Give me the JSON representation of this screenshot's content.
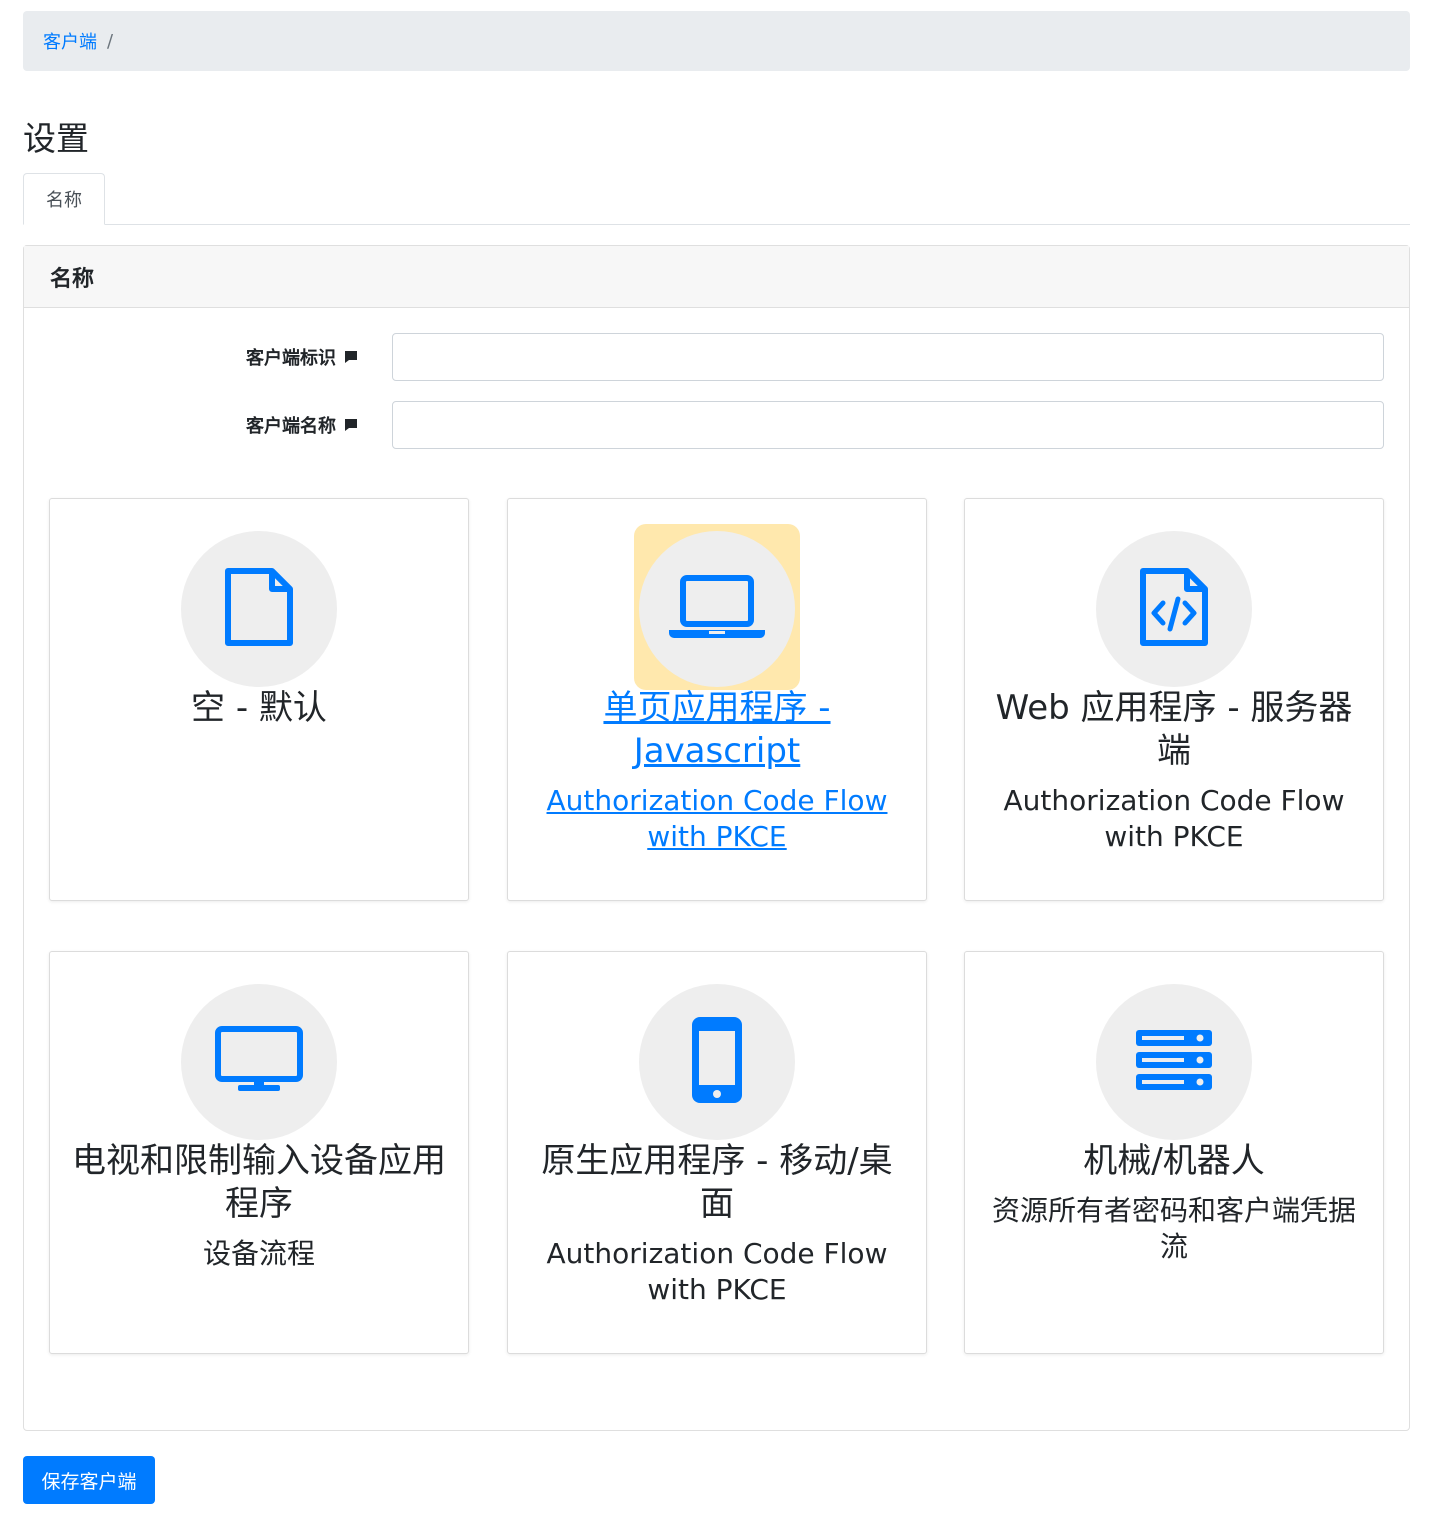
{
  "breadcrumb": {
    "link_label": "客户端",
    "separator": "/"
  },
  "page": {
    "title": "设置"
  },
  "tabs": [
    {
      "label": "名称"
    }
  ],
  "card": {
    "header": "名称"
  },
  "form": {
    "client_id_label": "客户端标识",
    "client_id_value": "",
    "client_name_label": "客户端名称",
    "client_name_value": ""
  },
  "client_types": [
    {
      "icon": "file-icon",
      "title": "空 - 默认",
      "subtitle": ""
    },
    {
      "icon": "laptop-icon",
      "title": "单页应用程序 - Javascript",
      "subtitle": "Authorization Code Flow with PKCE",
      "selected": true
    },
    {
      "icon": "file-code-icon",
      "title": "Web 应用程序 - 服务器端",
      "subtitle": "Authorization Code Flow with PKCE"
    },
    {
      "icon": "desktop-icon",
      "title": "电视和限制输入设备应用程序",
      "subtitle": "设备流程"
    },
    {
      "icon": "mobile-icon",
      "title": "原生应用程序 - 移动/桌面",
      "subtitle": "Authorization Code Flow with PKCE"
    },
    {
      "icon": "server-icon",
      "title": "机械/机器人",
      "subtitle": "资源所有者密码和客户端凭据流"
    }
  ],
  "actions": {
    "save_label": "保存客户端"
  },
  "colors": {
    "primary": "#007bff",
    "icon_bg": "#eeeeee",
    "highlight": "#ffe8ad",
    "breadcrumb_bg": "#e9ecef"
  }
}
